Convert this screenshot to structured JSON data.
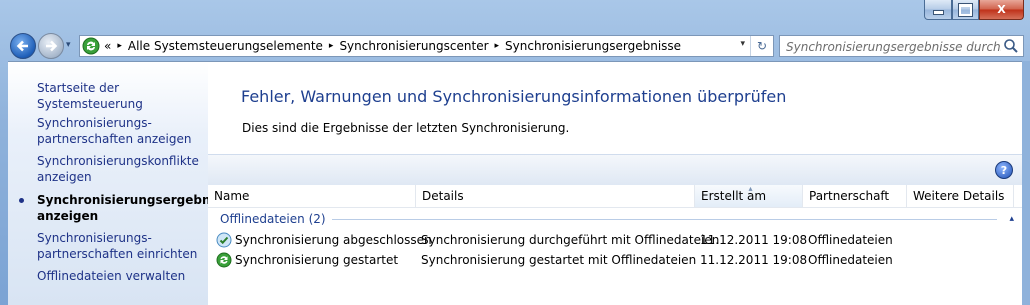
{
  "window": {
    "minimize_label": "",
    "maximize_label": "",
    "close_label": "X"
  },
  "nav": {
    "history_glyph": "▾"
  },
  "address": {
    "overflow": "«",
    "crumbs": [
      "Alle Systemsteuerungselemente",
      "Synchronisierungscenter",
      "Synchronisierungsergebnisse"
    ],
    "separator": "▸",
    "dropdown_glyph": "▾",
    "refresh_glyph": "↻"
  },
  "search": {
    "placeholder": "Synchronisierungsergebnisse durchsu..."
  },
  "sidebar": {
    "items": [
      {
        "label": "Startseite der Systemsteuerung"
      },
      {
        "label": "Synchronisierungs-\npartnerschaften anzeigen"
      },
      {
        "label": "Synchronisierungskonflikte anzeigen"
      },
      {
        "label": "Synchronisierungsergebnisse anzeigen"
      },
      {
        "label": "Synchronisierungs-\npartnerschaften einrichten"
      },
      {
        "label": "Offlinedateien verwalten"
      }
    ]
  },
  "main": {
    "heading": "Fehler, Warnungen und Synchronisierungsinformationen überprüfen",
    "subtext": "Dies sind die Ergebnisse der letzten Synchronisierung.",
    "help_glyph": "?"
  },
  "table": {
    "columns": [
      "Name",
      "Details",
      "Erstellt am",
      "Partnerschaft",
      "Weitere Details"
    ],
    "sort_glyph": "▴",
    "group": {
      "label": "Offlinedateien (2)",
      "collapse_glyph": "▴"
    },
    "rows": [
      {
        "name": "Synchronisierung abgeschlossen",
        "details": "Synchronisierung durchgeführt mit Offlinedateien",
        "created": "11.12.2011 19:08",
        "partnership": "Offlinedateien",
        "more": "",
        "icon": "check-icon"
      },
      {
        "name": "Synchronisierung gestartet",
        "details": "Synchronisierung gestartet mit Offlinedateien",
        "created": "11.12.2011 19:08",
        "partnership": "Offlinedateien",
        "more": "",
        "icon": "sync-icon"
      }
    ]
  },
  "colors": {
    "link": "#1e3287",
    "heading": "#1e3f8f",
    "chrome": "#8fb2db"
  }
}
